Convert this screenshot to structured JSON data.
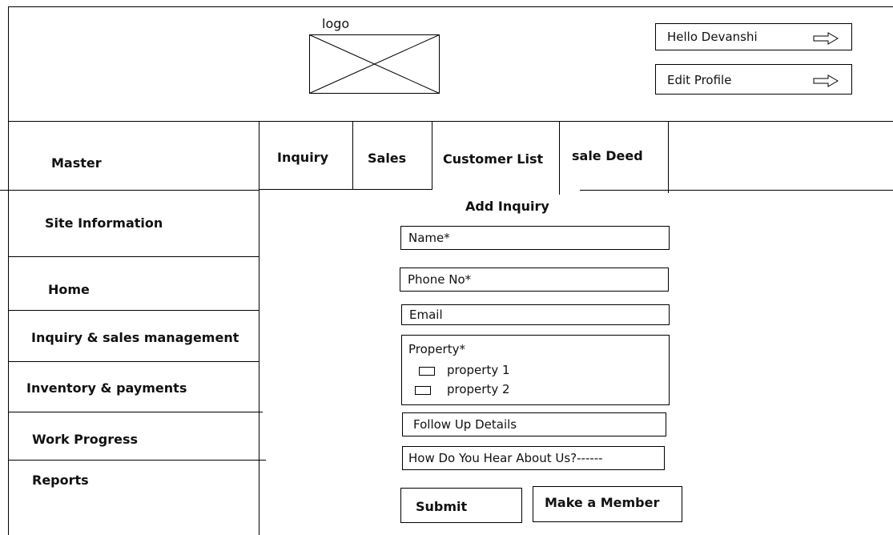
{
  "header": {
    "logo_label": "logo",
    "greeting": "Hello Devanshi",
    "edit_profile": "Edit Profile"
  },
  "sidebar": {
    "header": "Master",
    "items": [
      {
        "label": "Site Information"
      },
      {
        "label": "Home"
      },
      {
        "label": "Inquiry & sales management"
      },
      {
        "label": "Inventory & payments"
      },
      {
        "label": "Work Progress"
      },
      {
        "label": "Reports"
      }
    ]
  },
  "tabs": [
    {
      "label": "Inquiry"
    },
    {
      "label": "Sales"
    },
    {
      "label": "Customer List"
    },
    {
      "label": "sale Deed"
    }
  ],
  "form": {
    "title": "Add Inquiry",
    "name_placeholder": "Name*",
    "phone_placeholder": "Phone No*",
    "email_placeholder": "Email",
    "property_label": "Property*",
    "property_options": [
      {
        "label": "property 1"
      },
      {
        "label": "property 2"
      }
    ],
    "follow_up": "Follow Up Details",
    "hear_about": "How Do You Hear About Us?------",
    "submit": "Submit",
    "make_member": "Make a Member"
  },
  "icons": {
    "greeting_arrow": "right-arrow-icon",
    "edit_arrow": "right-arrow-icon",
    "logo": "image-placeholder-icon"
  }
}
